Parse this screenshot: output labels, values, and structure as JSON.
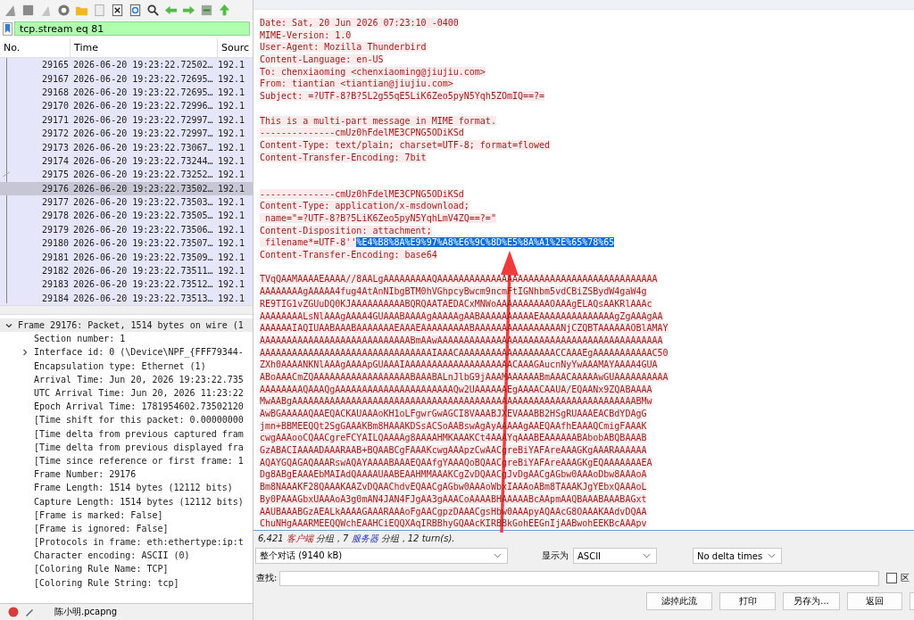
{
  "filter": {
    "value": "tcp.stream eq 81"
  },
  "packet_list": {
    "columns": [
      "No.",
      "Time",
      "Sourc"
    ],
    "rows": [
      {
        "no": "29165",
        "time": "2026-06-20 19:23:22.72502…",
        "source": "192.1",
        "selected": false,
        "related": false
      },
      {
        "no": "29167",
        "time": "2026-06-20 19:23:22.72695…",
        "source": "192.1",
        "selected": false,
        "related": false
      },
      {
        "no": "29168",
        "time": "2026-06-20 19:23:22.72695…",
        "source": "192.1",
        "selected": false,
        "related": false
      },
      {
        "no": "29170",
        "time": "2026-06-20 19:23:22.72996…",
        "source": "192.1",
        "selected": false,
        "related": false
      },
      {
        "no": "29171",
        "time": "2026-06-20 19:23:22.72997…",
        "source": "192.1",
        "selected": false,
        "related": false
      },
      {
        "no": "29172",
        "time": "2026-06-20 19:23:22.72997…",
        "source": "192.1",
        "selected": false,
        "related": false
      },
      {
        "no": "29173",
        "time": "2026-06-20 19:23:22.73067…",
        "source": "192.1",
        "selected": false,
        "related": false
      },
      {
        "no": "29174",
        "time": "2026-06-20 19:23:22.73244…",
        "source": "192.1",
        "selected": false,
        "related": false
      },
      {
        "no": "29175",
        "time": "2026-06-20 19:23:22.73252…",
        "source": "192.1",
        "selected": false,
        "related": true
      },
      {
        "no": "29176",
        "time": "2026-06-20 19:23:22.73502…",
        "source": "192.1",
        "selected": true,
        "related": false
      },
      {
        "no": "29177",
        "time": "2026-06-20 19:23:22.73503…",
        "source": "192.1",
        "selected": false,
        "related": false
      },
      {
        "no": "29178",
        "time": "2026-06-20 19:23:22.73505…",
        "source": "192.1",
        "selected": false,
        "related": false
      },
      {
        "no": "29179",
        "time": "2026-06-20 19:23:22.73506…",
        "source": "192.1",
        "selected": false,
        "related": false
      },
      {
        "no": "29180",
        "time": "2026-06-20 19:23:22.73507…",
        "source": "192.1",
        "selected": false,
        "related": false
      },
      {
        "no": "29181",
        "time": "2026-06-20 19:23:22.73509…",
        "source": "192.1",
        "selected": false,
        "related": false
      },
      {
        "no": "29182",
        "time": "2026-06-20 19:23:22.73511…",
        "source": "192.1",
        "selected": false,
        "related": false
      },
      {
        "no": "29183",
        "time": "2026-06-20 19:23:22.73512…",
        "source": "192.1",
        "selected": false,
        "related": false
      },
      {
        "no": "29184",
        "time": "2026-06-20 19:23:22.73513…",
        "source": "192.1",
        "selected": false,
        "related": false
      }
    ]
  },
  "details": [
    {
      "text": "Frame 29176: Packet, 1514 bytes on wire (1",
      "expanded": true,
      "children": [
        {
          "text": "Section number: 1"
        },
        {
          "text": "Interface id: 0 (\\Device\\NPF_{FFF79344-",
          "expanded": false
        },
        {
          "text": "Encapsulation type: Ethernet (1)"
        },
        {
          "text": "Arrival Time: Jun 20, 2026 19:23:22.735"
        },
        {
          "text": "UTC Arrival Time: Jun 20, 2026 11:23:22"
        },
        {
          "text": "Epoch Arrival Time: 1781954602.73502120"
        },
        {
          "text": "[Time shift for this packet: 0.00000000"
        },
        {
          "text": "[Time delta from previous captured fram"
        },
        {
          "text": "[Time delta from previous displayed fra"
        },
        {
          "text": "[Time since reference or first frame: 1"
        },
        {
          "text": "Frame Number: 29176"
        },
        {
          "text": "Frame Length: 1514 bytes (12112 bits)"
        },
        {
          "text": "Capture Length: 1514 bytes (12112 bits)"
        },
        {
          "text": "[Frame is marked: False]"
        },
        {
          "text": "[Frame is ignored: False]"
        },
        {
          "text": "[Protocols in frame: eth:ethertype:ip:t"
        },
        {
          "text": "Character encoding: ASCII (0)"
        },
        {
          "text": "[Coloring Rule Name: TCP]"
        },
        {
          "text": "[Coloring Rule String: tcp]"
        }
      ]
    }
  ],
  "status_bar": {
    "file": "陈小明.pcapng"
  },
  "stream": {
    "lines": [
      {
        "kind": "text",
        "text": "Date: Sat, 20 Jun 2026 07:23:10 -0400"
      },
      {
        "kind": "text",
        "text": "MIME-Version: 1.0"
      },
      {
        "kind": "text",
        "text": "User-Agent: Mozilla Thunderbird"
      },
      {
        "kind": "text",
        "text": "Content-Language: en-US"
      },
      {
        "kind": "text",
        "text": "To: chenxiaoming <chenxiaoming@jiujiu.com>"
      },
      {
        "kind": "text",
        "text": "From: tiantian <tiantian@jiujiu.com>"
      },
      {
        "kind": "text",
        "text": "Subject: =?UTF-8?B?5L2g55qE5LiK6Zeo5pyN5Yqh5ZOmIQ==?="
      },
      {
        "kind": "blank"
      },
      {
        "kind": "text",
        "text": "This is a multi-part message in MIME format."
      },
      {
        "kind": "text",
        "text": "--------------cmUz0hFdelME3CPNG5ODiKSd"
      },
      {
        "kind": "text",
        "text": "Content-Type: text/plain; charset=UTF-8; format=flowed"
      },
      {
        "kind": "text",
        "text": "Content-Transfer-Encoding: 7bit"
      },
      {
        "kind": "blank"
      },
      {
        "kind": "blank"
      },
      {
        "kind": "text",
        "text": "--------------cmUz0hFdelME3CPNG5ODiKSd"
      },
      {
        "kind": "text",
        "text": "Content-Type: application/x-msdownload;"
      },
      {
        "kind": "text",
        "text": " name=\"=?UTF-8?B?5LiK6Zeo5pyN5YqhLmV4ZQ==?=\""
      },
      {
        "kind": "text",
        "text": "Content-Disposition: attachment;"
      },
      {
        "kind": "text",
        "text": " filename*=UTF-8''",
        "selected_text": "%E4%B8%8A%E9%97%A8%E6%9C%8D%E5%8A%A1%2E%65%78%65"
      },
      {
        "kind": "text",
        "text": "Content-Transfer-Encoding: base64"
      },
      {
        "kind": "blank"
      },
      {
        "kind": "text",
        "text": "TVqQAAMAAAAEAAAA//8AALgAAAAAAAAAQAAAAAAAAAAAAAAAAAAAAAAAAAAAAAAAAAAAAAAAAA"
      },
      {
        "kind": "text",
        "text": "AAAAAAAAgAAAAA4fug4AtAnNIbgBTM0hVGhpcyBwcm9ncmFtIGNhbm5vdCBiZSBydW4gaW4g"
      },
      {
        "kind": "text",
        "text": "RE9TIG1vZGUuDQ0KJAAAAAAAAAABQRQAATAEDACxMNWoAAAAAAAAAAOAAAgELAQsAAKRlAAAc"
      },
      {
        "kind": "text",
        "text": "AAAAAAAALsNlAAAgAAAA4GUAAABAAAAgAAAAAgAABAAAAAAAAAAEAAAAAAAAAAAAAAgZgAAAgAA"
      },
      {
        "kind": "text",
        "text": "AAAAAAIAQIUAABAAABAAAAAAAEAAAEAAAAAAAAABAAAAAAAAAAAAAAAANjCZQBTAAAAAAOBlAMAY"
      },
      {
        "kind": "text",
        "text": "AAAAAAAAAAAAAAAAAAAAAAAAAAAABmAAwAAAAAAAAAAAAAAAAAAAAAAAAAAAAAAAAAAAAAAAAAA"
      },
      {
        "kind": "text",
        "text": "AAAAAAAAAAAAAAAAAAAAAAAAAAAAAAAAIAAACAAAAAAAAAAAAAAAAAACCAAAEgAAAAAAAAAAAC50"
      },
      {
        "kind": "text",
        "text": "ZXh0AAAANKNlAAAgAAAApGUAAAIAAAAAAAAAAAAAAAAAAAACAAAGAucnNyYwAAAMAYAAAA4GUA"
      },
      {
        "kind": "text",
        "text": "ABoAAACmZQAAAAAAAAAAAAAAAAAABAAABALnJlbG9jAAAMAAAAAABmAAACAAAAAwGUAAAAAAAAAA"
      },
      {
        "kind": "text",
        "text": "AAAAAAAAQAAAQgAAAAAAAAAAAAAAAAAAAAAAQw2UAAAAAAEgAAAACAAUA/EQAANx9ZQABAAAA"
      },
      {
        "kind": "text",
        "text": "MwAABgAAAAAAAAAAAAAAAAAAAAAAAAAAAAAAAAAAAAAAAAAAAAAAAAAAAAAAAAAAAAAAAABMw"
      },
      {
        "kind": "text",
        "text": "AwBGAAAAAQAAEQACKAUAAAoKH1oLFgwrGwAGCI8VAAABJXEVAAABB2HSgRUAAAEACBdYDAgG"
      },
      {
        "kind": "text",
        "text": "jmn+BBMEEQQt2SgGAAAKBm8HAAAKDSsACSoAABswAgAyAAAAAgAAEQAAfhEAAAQCmigFAAAK"
      },
      {
        "kind": "text",
        "text": "cwgAAAooCQAACgreFCYAILQAAAAg8AAAAHMKAAAKCt4AAAYqAAABEAAAAAABAbobABQBAAAB"
      },
      {
        "kind": "text",
        "text": "GzABACIAAAADAAARAAB+BQAABCgFAAAKcwgAAApzCwAACgreBiYAFAreAAAGKgAAARAAAAAA"
      },
      {
        "kind": "text",
        "text": "AQAYGQAGAQAAARswAQAYAAAABAAAEQAAfgYAAAQoBQAACgreBiYAFAreAAAGKgEQAAAAAAAEA"
      },
      {
        "kind": "text",
        "text": "Dg8ABgEAAAEbMAIAdQAAAAUAABEAAHMMAAAKCgZvDQAACgJvDgAACgAGbw0AAAoDbw8AAAoA"
      },
      {
        "kind": "text",
        "text": "Bm8NAAAKF28QAAAKAAZvDQAAChdvEQAACgAGbw0AAAoWbxIAAAoABm8TAAAKJgYEbxQAAAoL"
      },
      {
        "kind": "text",
        "text": "By0PAAAGbxUAAAoA3g0mAN4JAN4FJgAA3gAAACoAAAABHAAAAABcAApmAAQBAAABAAABAGxt"
      },
      {
        "kind": "text",
        "text": "AAUBAAABGzAEALkAAAAGAAARAAAoFgAACgpzDAAACgsHbw0AAApyAQAAcG8OAAAKAAdvDQAA"
      },
      {
        "kind": "text",
        "text": "ChuNHgAAARMEEQQWchEAAHCiEQQXAqIRBBhyGQAAcKIRBBkGohEEGnIjAABwohEEKBcAAApv"
      }
    ]
  },
  "summary": [
    {
      "kind": "plain",
      "text": "6,421 "
    },
    {
      "kind": "client",
      "text": "客户端"
    },
    {
      "kind": "plain",
      "text": " 分组，7 "
    },
    {
      "kind": "server",
      "text": "服务器"
    },
    {
      "kind": "plain",
      "text": " 分组，12 turn(s)."
    }
  ],
  "conversation_select": {
    "value": "整个对话 (9140 kB)"
  },
  "show_as": {
    "label": "显示为",
    "value": "ASCII"
  },
  "delta_select": {
    "value": "No delta times"
  },
  "find": {
    "label": "查找:"
  },
  "case_checkbox": {
    "label": "区",
    "checked": false
  },
  "buttons": [
    "滤掉此流",
    "打印",
    "另存为...",
    "返回"
  ]
}
